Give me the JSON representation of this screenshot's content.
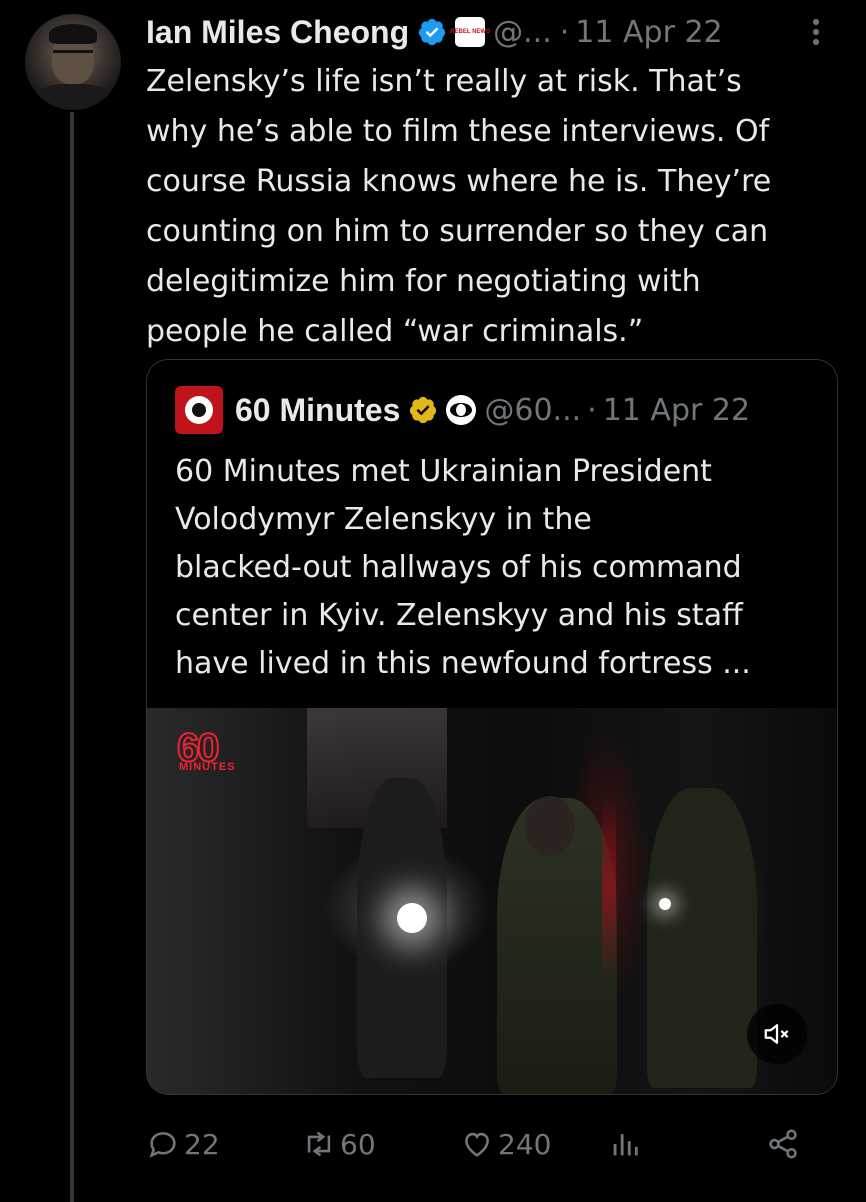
{
  "tweet": {
    "author_name": "Ian Miles Cheong",
    "affiliate_label": "REBEL NEWS",
    "handle": "@...",
    "separator": "·",
    "date": "11 Apr 22",
    "text_lines": [
      "Zelensky’s life isn’t really at risk. That’s",
      "why he’s able to film these interviews. Of",
      "course Russia knows where he is. They’re",
      "counting on him to surrender so they can",
      "delegitimize him for negotiating with",
      "people he called “war criminals.”"
    ]
  },
  "quoted_tweet": {
    "author_name": "60 Minutes",
    "handle": "@60...",
    "separator": "·",
    "date": "11 Apr 22",
    "text_lines": [
      "60 Minutes met Ukrainian President",
      "Volodymyr Zelenskyy in the",
      "blacked-out hallways of his command",
      "center in Kyiv. Zelenskyy and his staff",
      "have lived in this newfound fortress ..."
    ],
    "video_logo": "60",
    "video_logo_sub": "MINUTES"
  },
  "actions": {
    "replies": "22",
    "retweets": "60",
    "likes": "240"
  },
  "colors": {
    "background": "#000000",
    "text": "#e7e9ea",
    "secondary": "#71767b",
    "verified_blue": "#1d9bf0",
    "verified_gold": "#e2b719",
    "border": "#2f3336"
  }
}
